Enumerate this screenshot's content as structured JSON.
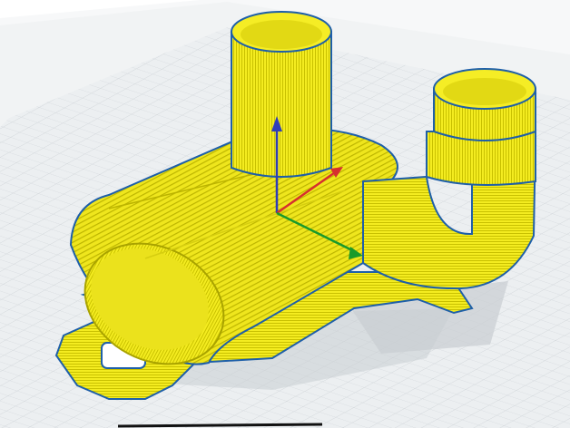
{
  "app": {
    "viewport_label": ""
  },
  "colors": {
    "background": "#ffffff",
    "grid_fill": "#e9ecef",
    "grid_line": "#cdd2d7",
    "model_fill": "#f2ea1f",
    "model_shade": "#c8c000",
    "model_dark": "#8c8600",
    "shell_outline": "#1e5fa8",
    "axis_x": "#d62f2f",
    "axis_y": "#2f3db8",
    "axis_z": "#1a9a2a",
    "shadow": "#c9cdd1"
  },
  "scene": {
    "view": "3d-layer-preview",
    "object": "elbow-pipe-with-mount-tab",
    "axes": [
      "x-axis",
      "y-axis",
      "z-axis"
    ]
  }
}
